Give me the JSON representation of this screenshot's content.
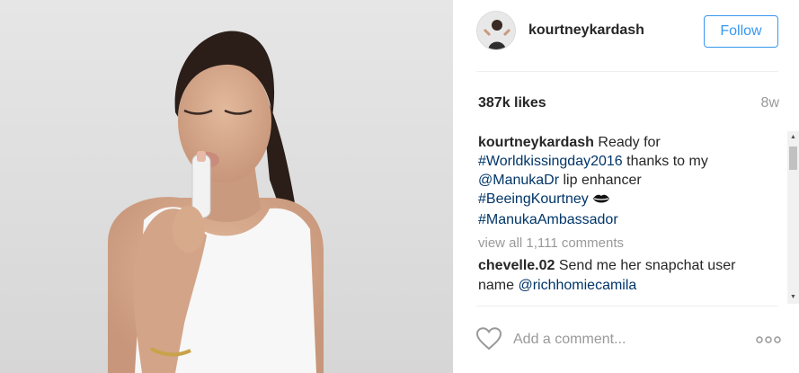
{
  "post": {
    "photo_description_icon": "post-photo",
    "author": {
      "username": "kourtneykardash",
      "avatar_icon": "profile-avatar"
    },
    "follow_label": "Follow",
    "likes": "387k likes",
    "age": "8w",
    "caption": {
      "username": "kourtneykardash",
      "text_1": " Ready for ",
      "tag_1": "#Worldkissingday2016",
      "text_2": " thanks to my ",
      "tag_2": "@ManukaDr",
      "text_3": " lip enhancer ",
      "tag_3": "#BeeingKourtney",
      "emoji_icon": "kiss-lips-icon",
      "tag_4": "#ManukaAmbassador"
    },
    "view_all_comments": "view all 1,111 comments",
    "comments": [
      {
        "username": "chevelle.02",
        "text": " Send me her snapchat user name ",
        "mention": "@richhomiecamila"
      }
    ],
    "comment_placeholder": "Add a comment...",
    "colors": {
      "accent": "#3897f0",
      "hashtag": "#003569",
      "muted": "#999999",
      "text": "#262626"
    }
  }
}
